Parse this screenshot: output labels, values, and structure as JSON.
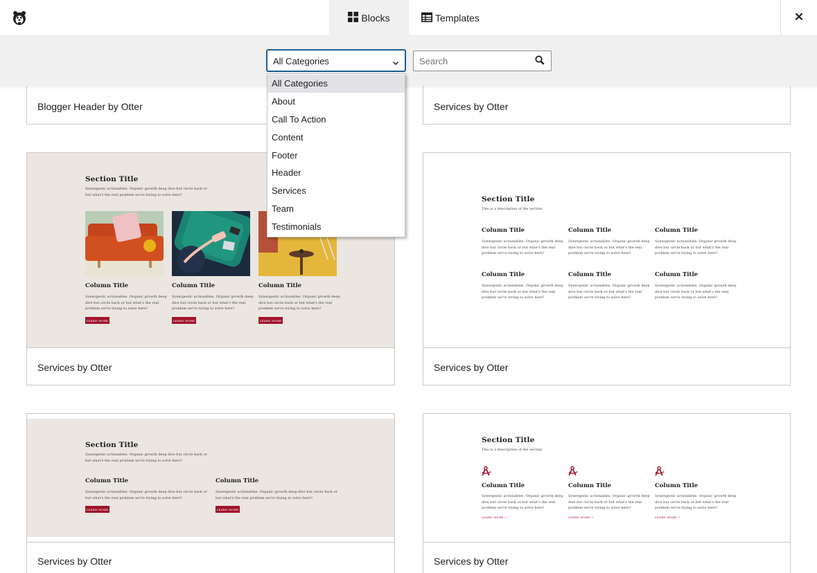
{
  "header": {
    "tabs": [
      {
        "label": "Blocks",
        "icon": "grid-icon",
        "active": true
      },
      {
        "label": "Templates",
        "icon": "table-icon",
        "active": false
      }
    ],
    "close_icon": "close-icon"
  },
  "filters": {
    "category_selected": "All Categories",
    "search_placeholder": "Search",
    "search_value": "",
    "category_options": [
      "All Categories",
      "About",
      "Call To Action",
      "Content",
      "Footer",
      "Header",
      "Services",
      "Team",
      "Testimonials"
    ]
  },
  "cards": [
    {
      "label": "Blogger Header by Otter"
    },
    {
      "label": "Services by Otter"
    },
    {
      "label": "Services by Otter",
      "section_title": "Section Title",
      "section_text": "Synergestic actionables. Organic growth deep dive but circle back or\nbut what's the real problem we're trying to solve here?",
      "columns": [
        {
          "title": "Column Title",
          "text": "Synergestic actionables. Organic growth deep\ndive but circle back or but what's the real\nproblem we're trying to solve here?",
          "button": "LEARN MORE"
        },
        {
          "title": "Column Title",
          "text": "Synergestic actionables. Organic growth deep\ndive but circle back or but what's the real\nproblem we're trying to solve here?",
          "button": "LEARN MORE"
        },
        {
          "title": "Column Title",
          "text": "Synergestic actionables. Organic growth deep\ndive but circle back or but what's the real\nproblem we're trying to solve here?",
          "button": "LEARN MORE"
        }
      ]
    },
    {
      "label": "Services by Otter",
      "section_title": "Section Title",
      "section_text": "This is a description of the section",
      "columns": [
        {
          "title": "Column Title",
          "text": "Synergestic actionables. Organic growth deep\ndive but circle back or but what's the real\nproblem we're trying to solve here?"
        },
        {
          "title": "Column Title",
          "text": "Synergestic actionables. Organic growth deep\ndive but circle back or but what's the real\nproblem we're trying to solve here?"
        },
        {
          "title": "Column Title",
          "text": "Synergestic actionables. Organic growth deep\ndive but circle back or but what's the real\nproblem we're trying to solve here?"
        },
        {
          "title": "Column Title",
          "text": "Synergestic actionables. Organic growth deep\ndive but circle back or but what's the real\nproblem we're trying to solve here?"
        },
        {
          "title": "Column Title",
          "text": "Synergestic actionables. Organic growth deep\ndive but circle back or but what's the real\nproblem we're trying to solve here?"
        },
        {
          "title": "Column Title",
          "text": "Synergestic actionables. Organic growth deep\ndive but circle back or but what's the real\nproblem we're trying to solve here?"
        }
      ]
    },
    {
      "label": "Services by Otter",
      "section_title": "Section Title",
      "section_text": "Synergestic actionables. Organic growth deep dive but circle back or\nbut what's the real problem we're trying to solve here?",
      "columns": [
        {
          "title": "Column Title",
          "text": "Synergestic actionables. Organic growth deep dive but circle back or\nbut what's the real problem we're trying to solve here?",
          "button": "LEARN MORE"
        },
        {
          "title": "Column Title",
          "text": "Synergestic actionables. Organic growth deep dive but circle back or\nbut what's the real problem we're trying to solve here?",
          "button": "LEARN MORE"
        }
      ]
    },
    {
      "label": "Services by Otter",
      "section_title": "Section Title",
      "section_text": "This is a description of the section",
      "columns": [
        {
          "title": "Column Title",
          "text": "Synergestic actionables. Organic growth deep\ndive but circle back or but what's the real\nproblem we're trying to solve here?",
          "link": "LEARN MORE"
        },
        {
          "title": "Column Title",
          "text": "Synergestic actionables. Organic growth deep\ndive but circle back or but what's the real\nproblem we're trying to solve here?",
          "link": "LEARN MORE"
        },
        {
          "title": "Column Title",
          "text": "Synergestic actionables. Organic growth deep\ndive but circle back or but what's the real\nproblem we're trying to solve here?",
          "link": "LEARN MORE"
        }
      ]
    }
  ],
  "colors": {
    "accent_red": "#a1132a",
    "preview_beige": "#ebe6e1",
    "focus_blue": "#1e5d8a",
    "filter_bg": "#f0f0f0"
  }
}
